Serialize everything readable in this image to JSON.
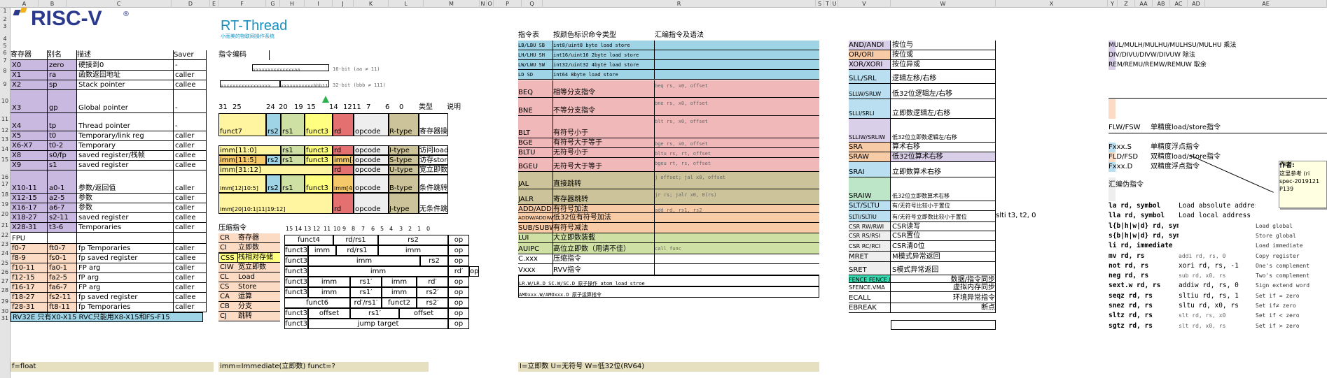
{
  "sheet": {
    "col_headers": [
      "A",
      "B",
      "C",
      "D",
      "E",
      "F",
      "G",
      "H",
      "I",
      "J",
      "K",
      "L",
      "M",
      "N",
      "O",
      "P",
      "Q",
      "R",
      "S",
      "T",
      "U",
      "V",
      "W",
      "X",
      "Y",
      "Z",
      "AA",
      "AB",
      "AC",
      "AD",
      "AE"
    ],
    "row_headers": [
      "1",
      "2",
      "3",
      "4",
      "5",
      "6",
      "7",
      "8",
      "9",
      "10",
      "11",
      "12",
      "13",
      "14",
      "15",
      "16",
      "17",
      "18",
      "19",
      "20",
      "21",
      "22",
      "23",
      "24",
      "25",
      "26",
      "27",
      "28",
      "29",
      "30",
      "31"
    ]
  },
  "logos": {
    "riscv": "RISC-V",
    "rtthread": "RT-Thread",
    "rtthread_sub": "小而美的物联网操作系统",
    "reg": "®"
  },
  "registers": {
    "headers": [
      "寄存器",
      "别名",
      "描述",
      "Saver"
    ],
    "rows": [
      [
        "X0",
        "zero",
        "硬接到0",
        "-"
      ],
      [
        "X1",
        "ra",
        "函数返回地址",
        "caller"
      ],
      [
        "X2",
        "sp",
        "Stack pointer",
        "callee"
      ],
      [
        "X3",
        "gp",
        "Global pointer",
        "-"
      ],
      [
        "X4",
        "tp",
        "Thread pointer",
        "-"
      ],
      [
        "X5",
        "t0",
        "Temporary/link reg",
        "caller"
      ],
      [
        "X6-X7",
        "t0-2",
        "Temporary",
        "caller"
      ],
      [
        "X8",
        "s0/fp",
        "saved register/栈帧",
        "callee"
      ],
      [
        "X9",
        "s1",
        "saved register",
        "callee"
      ],
      [
        "X10-11",
        "a0-1",
        "参数/返回值",
        "caller"
      ],
      [
        "X12-15",
        "a2-5",
        "参数",
        "caller"
      ],
      [
        "X16-17",
        "a6-7",
        "参数",
        "caller"
      ],
      [
        "X18-27",
        "s2-11",
        "saved register",
        "callee"
      ],
      [
        "X28-31",
        "t3-6",
        "Temporaries",
        "caller"
      ],
      [
        "FPU",
        "",
        "",
        ""
      ],
      [
        "f0-7",
        "ft0-7",
        "fp Temporaries",
        "caller"
      ],
      [
        "f8-9",
        "fs0-1",
        "fp saved register",
        "callee"
      ],
      [
        "f10-11",
        "fa0-1",
        "FP arg",
        "caller"
      ],
      [
        "f12-15",
        "fa2-5",
        "fP arg",
        "caller"
      ],
      [
        "f16-17",
        "fa6-7",
        "FP arg",
        "caller"
      ],
      [
        "f18-27",
        "fs2-11",
        "fp saved register",
        "callee"
      ],
      [
        "f28-31",
        "ft8-11",
        "fp Temporaries",
        "caller"
      ]
    ],
    "rv32e": "RV32E  只有X0-X15    RVC只能用X8-X15和FS-F15",
    "f_float": "f=float"
  },
  "encoding": {
    "title": "指令编码",
    "enc16": "xxxxxxxxxxxxxxaa",
    "enc16_note": "16-bit (aa ≠ 11)",
    "enc32a": "xxxxxxxxxxxxxxxxx",
    "enc32b": "xxxxxxxxxxxbbb11",
    "enc32_note": "32-bit (bbb ≠ 111)",
    "bit_headers": [
      "31",
      "25",
      "24",
      "20",
      "19",
      "15",
      "14",
      "12",
      "11",
      "7",
      "6",
      "0",
      "类型",
      "说明"
    ],
    "formats": [
      {
        "cells": [
          "funct7",
          "rs2",
          "rs1",
          "funct3",
          "rd",
          "opcode"
        ],
        "type": "R-type",
        "desc": "寄存器操作"
      },
      {
        "cells": [
          "imm[11:0]",
          "rs1",
          "funct3",
          "rd",
          "opcode"
        ],
        "type": "I-type",
        "desc": "访问load"
      },
      {
        "cells": [
          "imm[11:5]",
          "rs2",
          "rs1",
          "funct3",
          "imm[4:0]",
          "opcode"
        ],
        "type": "S-type",
        "desc": "访存store"
      },
      {
        "cells": [
          "imm[31:12]",
          "rd",
          "opcode"
        ],
        "type": "U-type",
        "desc": "宽立即数"
      },
      {
        "cells": [
          "imm[12|10:5]",
          "rs2",
          "rs1",
          "funct3",
          "imm[4:1|11]",
          "opcode"
        ],
        "type": "B-type",
        "desc": "条件跳转"
      },
      {
        "cells": [
          "imm[20|10:1|11|19:12]",
          "rd",
          "opcode"
        ],
        "type": "J-type",
        "desc": "无条件跳转"
      }
    ],
    "imm_note": "imm=Immediate(立即数)    funct=?"
  },
  "compressed": {
    "title": "压缩指令",
    "list": [
      [
        "CR",
        "寄存器"
      ],
      [
        "CI",
        "立即数"
      ],
      [
        "CSS",
        "栈相对存储"
      ],
      [
        "CIW",
        "宽立即数"
      ],
      [
        "CL",
        "Load"
      ],
      [
        "CS",
        "Store"
      ],
      [
        "CA",
        "运算"
      ],
      [
        "CB",
        "分支"
      ],
      [
        "CJ",
        "跳转"
      ]
    ],
    "bits": [
      "15",
      "14",
      "13",
      "12",
      "11",
      "10",
      "9",
      "8",
      "7",
      "6",
      "5",
      "4",
      "3",
      "2",
      "1",
      "0"
    ],
    "rows": [
      [
        "funct4",
        "rd/rs1",
        "rs2",
        "op"
      ],
      [
        "funct3",
        "imm",
        "rd/rs1",
        "imm",
        "op"
      ],
      [
        "funct3",
        "imm",
        "rs2",
        "op"
      ],
      [
        "funct3",
        "imm",
        "rd′",
        "op"
      ],
      [
        "funct3",
        "imm",
        "rs1′",
        "imm",
        "rd′",
        "op"
      ],
      [
        "funct3",
        "imm",
        "rs1′",
        "imm",
        "rs2′",
        "op"
      ],
      [
        "funct6",
        "rd′/rs1′",
        "funct2",
        "rs2′",
        "op"
      ],
      [
        "funct3",
        "offset",
        "rs1′",
        "offset",
        "op"
      ],
      [
        "funct3",
        "jump target",
        "op"
      ]
    ]
  },
  "instr": {
    "headers": [
      "指令表",
      "按颜色标识命令类型",
      "汇编指令及语法"
    ],
    "rows": [
      [
        "LB/LBU SB",
        "int8/uint8   byte load store",
        ""
      ],
      [
        "LH/LHU SH",
        "int16/uint16 2byte load store",
        ""
      ],
      [
        "LW/LWU SW",
        "int32/uint32 4byte load store",
        ""
      ],
      [
        "LD SD",
        "int64        8byte load store",
        ""
      ],
      [
        "BEQ",
        "相等分支指令",
        "beq rs, x0, offset"
      ],
      [
        "BNE",
        "不等分支指令",
        "bne rs, x0, offset"
      ],
      [
        "BLT",
        "有符号小于",
        "blt rs, x0, offset"
      ],
      [
        "BGE",
        "有符号大于等于",
        "bge rs, x0, offset"
      ],
      [
        "BLTU",
        "无符号小于",
        "bltu rs, rt, offset"
      ],
      [
        "BGEU",
        "无符号大于等于",
        "bgeu rt, rs, offset"
      ],
      [
        "JAL",
        "直接跳转",
        "j offset; jal x0, offset"
      ],
      [
        "JALR",
        "寄存器跳转",
        "jr rs; jalr x0, 0(rs)"
      ],
      [
        "ADD/ADDI",
        "有符号加法",
        "add rd, rs1, rs2"
      ],
      [
        "ADDW/ADDIW",
        "低32位有符号加法",
        ""
      ],
      [
        "SUB/SUBW",
        "有符号减法",
        ""
      ],
      [
        "LUI",
        "大立即数装载",
        ""
      ],
      [
        "AUIPC",
        "高位立即数（用请不佳）",
        "call func"
      ],
      [
        "C.xxx",
        "压缩指令",
        ""
      ],
      [
        "Vxxx",
        "RVV指令",
        ""
      ],
      [
        "LR.W/LR.D SC.W/SC.D 原子操作 atom load stroe",
        "",
        ""
      ],
      [
        "AMOxxx.W/AMOxxx.D 原子运算指令",
        "",
        ""
      ]
    ],
    "note": "I=立即数 U=无符号 W=低32位(RV64)"
  },
  "logic": {
    "rows": [
      [
        "AND/ANDI",
        "按位与"
      ],
      [
        "OR/ORI",
        "按位或"
      ],
      [
        "XOR/XORI",
        "按位异或"
      ],
      [
        "SLL/SRL",
        "逻辑左移/右移"
      ],
      [
        "SLLW/SRLW",
        "低32位逻辑左/右移"
      ],
      [
        "SLLI/SRLI",
        "立即数逻辑左/右移"
      ],
      [
        "SLLIW/SRLIW",
        "低32位立即数逻辑左/右移"
      ],
      [
        "SRA",
        "算术右移"
      ],
      [
        "SRAW",
        "低32位算术右移"
      ],
      [
        "SRAI",
        "立即数算术右移"
      ],
      [
        "SRAIW",
        "低32位立即数算术右移"
      ],
      [
        "SLT/SLTU",
        "有/无符号比较小于置位"
      ],
      [
        "SLTI/SLTIU",
        "有/无符号立即数比较小于置位"
      ],
      [
        "CSR RW/RWI",
        "CSR读写"
      ],
      [
        "CSR RS/RSI",
        "CSR置位"
      ],
      [
        "CSR RC/RCI",
        "CSR清0位"
      ],
      [
        "MRET",
        "M模式异常返回"
      ],
      [
        "SRET",
        "S模式异常返回"
      ],
      [
        "FENCE FENCE.I",
        "数据/指令同步"
      ],
      [
        "SFENCE.VMA",
        "虚拟内存同步"
      ],
      [
        "ECALL",
        "环境异常指令"
      ],
      [
        "EBREAK",
        "断点"
      ]
    ],
    "slti_example": "slti t3, t2, 0"
  },
  "right": {
    "mul": "MUL/MULH/MULHU/MULHSU/MULHU 乘法",
    "div": "DIV/DIVU/DIVW/DIVUW 除法",
    "rem": "REM/REMU/REMW/REMUW 取余",
    "flw": "FLW/FSW",
    "flw_desc": "单精度load/store指令",
    "fxxxs": "Fxxx.S",
    "fxxxs_desc": "单精度浮点指令",
    "fld": "FLD/FSD",
    "fld_desc": "双精度load/store指令",
    "fxxxd": "Fxxx.D",
    "fxxxd_desc": "双精度浮点指令",
    "pseudo_title": "汇编伪指令",
    "pseudo": [
      [
        "la rd, symbol",
        "Load absolute address",
        ""
      ],
      [
        "lla rd, symbol",
        "Load local address",
        ""
      ],
      [
        "l{b|h|w|d} rd, symbol",
        "",
        "Load global"
      ],
      [
        "s{b|h|w|d} rd, symbol, rt",
        "",
        "Store global"
      ],
      [
        "li rd, immediate",
        "",
        "Load immediate"
      ],
      [
        "mv rd, rs",
        "addi rd, rs, 0",
        "Copy register"
      ],
      [
        "not rd, rs",
        "xori rd, rs, -1",
        "One's complement"
      ],
      [
        "neg rd, rs",
        "sub rd, x0, rs",
        "Two's complement"
      ],
      [
        "sext.w rd, rs",
        "addiw rd, rs, 0",
        "Sign extend word"
      ],
      [
        "seqz rd, rs",
        "sltiu rd, rs, 1",
        "Set if = zero"
      ],
      [
        "snez rd, rs",
        "sltu rd, x0, rs",
        "Set if≠ zero"
      ],
      [
        "sltz rd, rs",
        "slt rd, rs, x0",
        "Set if < zero"
      ],
      [
        "sgtz rd, rs",
        "slt rd, x0, rs",
        "Set if > zero"
      ]
    ],
    "comment_title": "作者:",
    "comment_lines": [
      "这里参考 (ri",
      "spec-2019121",
      "P139"
    ]
  }
}
